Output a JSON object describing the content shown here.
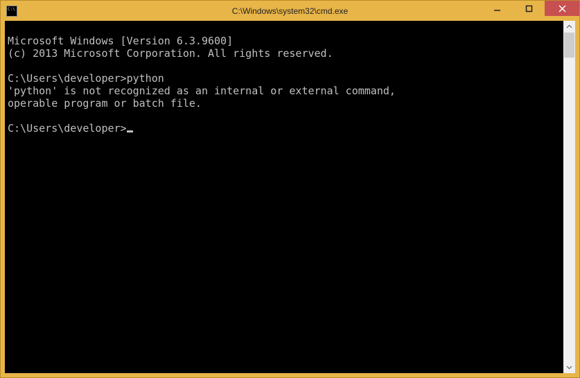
{
  "window": {
    "title": "C:\\Windows\\system32\\cmd.exe"
  },
  "console": {
    "banner_version": "Microsoft Windows [Version 6.3.9600]",
    "banner_copyright": "(c) 2013 Microsoft Corporation. All rights reserved.",
    "prompt1": "C:\\Users\\developer>",
    "command1": "python",
    "error_line1": "'python' is not recognized as an internal or external command,",
    "error_line2": "operable program or batch file.",
    "prompt2": "C:\\Users\\developer>"
  }
}
